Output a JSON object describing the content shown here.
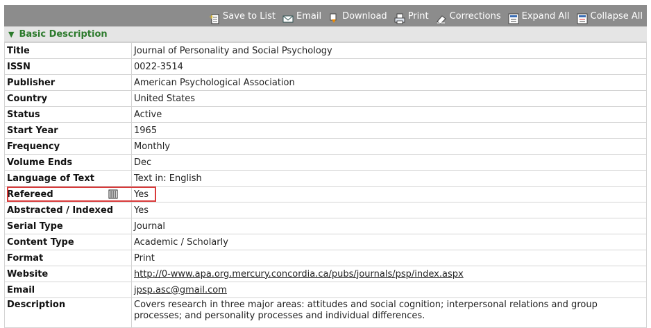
{
  "toolbar": {
    "save_to_list": "Save to List",
    "email": "Email",
    "download": "Download",
    "print": "Print",
    "corrections": "Corrections",
    "expand_all": "Expand All",
    "collapse_all": "Collapse All"
  },
  "section": {
    "title": "Basic Description"
  },
  "rows": [
    {
      "label": "Title",
      "value": "Journal of Personality and Social Psychology"
    },
    {
      "label": "ISSN",
      "value": "0022-3514"
    },
    {
      "label": "Publisher",
      "value": "American Psychological Association"
    },
    {
      "label": "Country",
      "value": "United States"
    },
    {
      "label": "Status",
      "value": "Active"
    },
    {
      "label": "Start Year",
      "value": "1965"
    },
    {
      "label": "Frequency",
      "value": "Monthly"
    },
    {
      "label": "Volume Ends",
      "value": "Dec"
    },
    {
      "label": "Language of Text",
      "value": "Text in: English"
    },
    {
      "label": "Refereed",
      "value": "Yes"
    },
    {
      "label": "Abstracted / Indexed",
      "value": "Yes"
    },
    {
      "label": "Serial Type",
      "value": "Journal"
    },
    {
      "label": "Content Type",
      "value": "Academic / Scholarly"
    },
    {
      "label": "Format",
      "value": "Print"
    },
    {
      "label": "Website",
      "value": "http://0-www.apa.org.mercury.concordia.ca/pubs/journals/psp/index.aspx"
    },
    {
      "label": "Email",
      "value": "jpsp.asc@gmail.com"
    },
    {
      "label": "Description",
      "value": "Covers research in three major areas: attitudes and social cognition; interpersonal relations and group processes; and personality processes and individual differences."
    }
  ],
  "icons": {
    "save_to_list": "add-document-icon",
    "email": "envelope-icon",
    "download": "download-arrow-icon",
    "print": "printer-icon",
    "corrections": "eraser-icon",
    "expand_all": "expand-icon",
    "collapse_all": "collapse-icon",
    "refereed": "refereed-icon"
  },
  "colors": {
    "toolbar_bg": "#8c8c8c",
    "section_title": "#2c7a2c",
    "highlight": "#d93a3a"
  }
}
